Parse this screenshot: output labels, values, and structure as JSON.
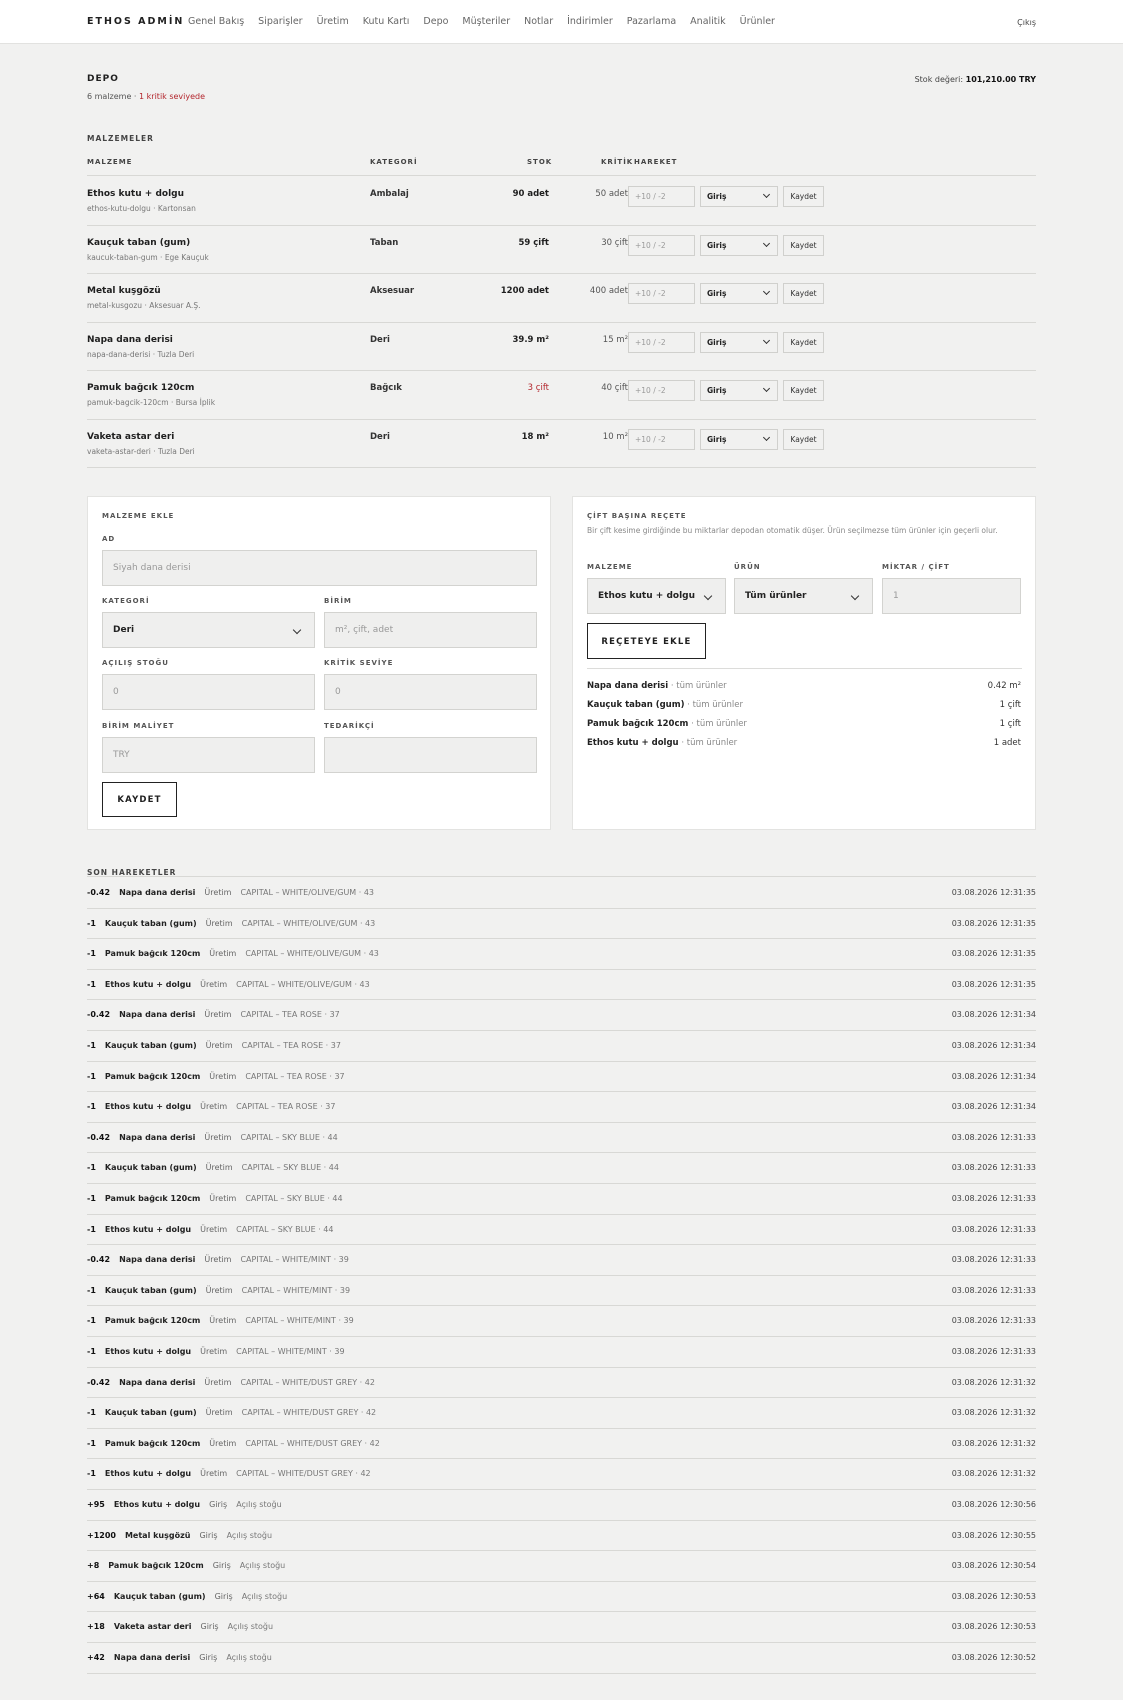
{
  "brand": "ETHOS ADMİN",
  "nav": [
    "Genel Bakış",
    "Siparişler",
    "Üretim",
    "Kutu Kartı",
    "Depo",
    "Müşteriler",
    "Notlar",
    "İndirimler",
    "Pazarlama",
    "Analitik",
    "Ürünler"
  ],
  "logout": "Çıkış",
  "page": {
    "title": "DEPO",
    "subtitle_count": "6 malzeme",
    "subtitle_sep": " · ",
    "subtitle_critical": "1 kritik seviyede",
    "stock_value_label": "Stok değeri:",
    "stock_value": "101,210.00 TRY"
  },
  "colors": {
    "critical": "#b3262d",
    "background": "#f1f1f0",
    "card": "#ffffff"
  },
  "materials": {
    "section_label": "MALZEMELER",
    "headers": {
      "name": "MALZEME",
      "category": "KATEGORİ",
      "stock": "STOK",
      "critical": "KRİTİK",
      "movement": "HAREKET"
    },
    "delta_placeholder": "+10 / -2",
    "movement_option": "Giriş",
    "save_label": "Kaydet",
    "rows": [
      {
        "name": "Ethos kutu + dolgu",
        "sub": "ethos-kutu-dolgu · Kartonsan",
        "category": "Ambalaj",
        "stock": "90 adet",
        "critical": "50 adet",
        "is_critical": false
      },
      {
        "name": "Kauçuk taban (gum)",
        "sub": "kaucuk-taban-gum · Ege Kauçuk",
        "category": "Taban",
        "stock": "59 çift",
        "critical": "30 çift",
        "is_critical": false
      },
      {
        "name": "Metal kuşgözü",
        "sub": "metal-kusgozu · Aksesuar A.Ş.",
        "category": "Aksesuar",
        "stock": "1200 adet",
        "critical": "400 adet",
        "is_critical": false
      },
      {
        "name": "Napa dana derisi",
        "sub": "napa-dana-derisi · Tuzla Deri",
        "category": "Deri",
        "stock": "39.9 m²",
        "critical": "15 m²",
        "is_critical": false
      },
      {
        "name": "Pamuk bağcık 120cm",
        "sub": "pamuk-bagcik-120cm · Bursa İplik",
        "category": "Bağcık",
        "stock": "3 çift",
        "critical": "40 çift",
        "is_critical": true
      },
      {
        "name": "Vaketa astar deri",
        "sub": "vaketa-astar-deri · Tuzla Deri",
        "category": "Deri",
        "stock": "18 m²",
        "critical": "10 m²",
        "is_critical": false
      }
    ]
  },
  "add_material": {
    "title": "MALZEME EKLE",
    "name_label": "AD",
    "name_placeholder": "Siyah dana derisi",
    "category_label": "KATEGORİ",
    "category_value": "Deri",
    "unit_label": "BİRİM",
    "unit_placeholder": "m², çift, adet",
    "opening_label": "AÇILIŞ STOĞU",
    "opening_placeholder": "0",
    "critical_label": "KRİTİK SEVİYE",
    "critical_placeholder": "0",
    "cost_label": "BİRİM MALİYET",
    "cost_placeholder": "TRY",
    "supplier_label": "TEDARİKÇİ",
    "supplier_placeholder": "",
    "save_label": "KAYDET"
  },
  "recipe": {
    "title": "ÇİFT BAŞINA REÇETE",
    "description": "Bir çift kesime girdiğinde bu miktarlar depodan otomatik düşer. Ürün seçilmezse tüm ürünler için geçerli olur.",
    "material_label": "MALZEME",
    "material_value": "Ethos kutu + dolgu",
    "product_label": "ÜRÜN",
    "product_value": "Tüm ürünler",
    "qty_label": "MİKTAR / ÇİFT",
    "qty_placeholder": "1",
    "add_label": "REÇETEYE EKLE",
    "items": [
      {
        "material": "Napa dana derisi",
        "scope": " · tüm ürünler",
        "qty": "0.42 m²"
      },
      {
        "material": "Kauçuk taban (gum)",
        "scope": " · tüm ürünler",
        "qty": "1 çift"
      },
      {
        "material": "Pamuk bağcık 120cm",
        "scope": " · tüm ürünler",
        "qty": "1 çift"
      },
      {
        "material": "Ethos kutu + dolgu",
        "scope": " · tüm ürünler",
        "qty": "1 adet"
      }
    ]
  },
  "movements": {
    "section_label": "SON HAREKETLER",
    "items": [
      {
        "qty": "-0.42",
        "material": "Napa dana derisi",
        "type": "Üretim",
        "note": "CAPITAL – WHITE/OLIVE/GUM · 43",
        "time": "03.08.2026 12:31:35"
      },
      {
        "qty": "-1",
        "material": "Kauçuk taban (gum)",
        "type": "Üretim",
        "note": "CAPITAL – WHITE/OLIVE/GUM · 43",
        "time": "03.08.2026 12:31:35"
      },
      {
        "qty": "-1",
        "material": "Pamuk bağcık 120cm",
        "type": "Üretim",
        "note": "CAPITAL – WHITE/OLIVE/GUM · 43",
        "time": "03.08.2026 12:31:35"
      },
      {
        "qty": "-1",
        "material": "Ethos kutu + dolgu",
        "type": "Üretim",
        "note": "CAPITAL – WHITE/OLIVE/GUM · 43",
        "time": "03.08.2026 12:31:35"
      },
      {
        "qty": "-0.42",
        "material": "Napa dana derisi",
        "type": "Üretim",
        "note": "CAPITAL – TEA ROSE · 37",
        "time": "03.08.2026 12:31:34"
      },
      {
        "qty": "-1",
        "material": "Kauçuk taban (gum)",
        "type": "Üretim",
        "note": "CAPITAL – TEA ROSE · 37",
        "time": "03.08.2026 12:31:34"
      },
      {
        "qty": "-1",
        "material": "Pamuk bağcık 120cm",
        "type": "Üretim",
        "note": "CAPITAL – TEA ROSE · 37",
        "time": "03.08.2026 12:31:34"
      },
      {
        "qty": "-1",
        "material": "Ethos kutu + dolgu",
        "type": "Üretim",
        "note": "CAPITAL – TEA ROSE · 37",
        "time": "03.08.2026 12:31:34"
      },
      {
        "qty": "-0.42",
        "material": "Napa dana derisi",
        "type": "Üretim",
        "note": "CAPITAL – SKY BLUE · 44",
        "time": "03.08.2026 12:31:33"
      },
      {
        "qty": "-1",
        "material": "Kauçuk taban (gum)",
        "type": "Üretim",
        "note": "CAPITAL – SKY BLUE · 44",
        "time": "03.08.2026 12:31:33"
      },
      {
        "qty": "-1",
        "material": "Pamuk bağcık 120cm",
        "type": "Üretim",
        "note": "CAPITAL – SKY BLUE · 44",
        "time": "03.08.2026 12:31:33"
      },
      {
        "qty": "-1",
        "material": "Ethos kutu + dolgu",
        "type": "Üretim",
        "note": "CAPITAL – SKY BLUE · 44",
        "time": "03.08.2026 12:31:33"
      },
      {
        "qty": "-0.42",
        "material": "Napa dana derisi",
        "type": "Üretim",
        "note": "CAPITAL – WHITE/MINT · 39",
        "time": "03.08.2026 12:31:33"
      },
      {
        "qty": "-1",
        "material": "Kauçuk taban (gum)",
        "type": "Üretim",
        "note": "CAPITAL – WHITE/MINT · 39",
        "time": "03.08.2026 12:31:33"
      },
      {
        "qty": "-1",
        "material": "Pamuk bağcık 120cm",
        "type": "Üretim",
        "note": "CAPITAL – WHITE/MINT · 39",
        "time": "03.08.2026 12:31:33"
      },
      {
        "qty": "-1",
        "material": "Ethos kutu + dolgu",
        "type": "Üretim",
        "note": "CAPITAL – WHITE/MINT · 39",
        "time": "03.08.2026 12:31:33"
      },
      {
        "qty": "-0.42",
        "material": "Napa dana derisi",
        "type": "Üretim",
        "note": "CAPITAL – WHITE/DUST GREY · 42",
        "time": "03.08.2026 12:31:32"
      },
      {
        "qty": "-1",
        "material": "Kauçuk taban (gum)",
        "type": "Üretim",
        "note": "CAPITAL – WHITE/DUST GREY · 42",
        "time": "03.08.2026 12:31:32"
      },
      {
        "qty": "-1",
        "material": "Pamuk bağcık 120cm",
        "type": "Üretim",
        "note": "CAPITAL – WHITE/DUST GREY · 42",
        "time": "03.08.2026 12:31:32"
      },
      {
        "qty": "-1",
        "material": "Ethos kutu + dolgu",
        "type": "Üretim",
        "note": "CAPITAL – WHITE/DUST GREY · 42",
        "time": "03.08.2026 12:31:32"
      },
      {
        "qty": "+95",
        "material": "Ethos kutu + dolgu",
        "type": "Giriş",
        "note": "Açılış stoğu",
        "time": "03.08.2026 12:30:56"
      },
      {
        "qty": "+1200",
        "material": "Metal kuşgözü",
        "type": "Giriş",
        "note": "Açılış stoğu",
        "time": "03.08.2026 12:30:55"
      },
      {
        "qty": "+8",
        "material": "Pamuk bağcık 120cm",
        "type": "Giriş",
        "note": "Açılış stoğu",
        "time": "03.08.2026 12:30:54"
      },
      {
        "qty": "+64",
        "material": "Kauçuk taban (gum)",
        "type": "Giriş",
        "note": "Açılış stoğu",
        "time": "03.08.2026 12:30:53"
      },
      {
        "qty": "+18",
        "material": "Vaketa astar deri",
        "type": "Giriş",
        "note": "Açılış stoğu",
        "time": "03.08.2026 12:30:53"
      },
      {
        "qty": "+42",
        "material": "Napa dana derisi",
        "type": "Giriş",
        "note": "Açılış stoğu",
        "time": "03.08.2026 12:30:52"
      }
    ]
  }
}
